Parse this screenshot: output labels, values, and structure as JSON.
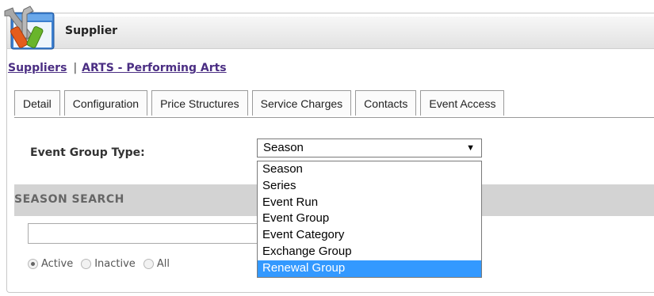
{
  "window": {
    "title": "Supplier"
  },
  "breadcrumb": {
    "items": [
      "Suppliers",
      "ARTS - Performing Arts"
    ],
    "separator": "|"
  },
  "tabs": [
    "Detail",
    "Configuration",
    "Price Structures",
    "Service Charges",
    "Contacts",
    "Event Access"
  ],
  "event_group_type": {
    "label": "Event Group Type:",
    "value": "Season",
    "options": [
      "Season",
      "Series",
      "Event Run",
      "Event Group",
      "Event Category",
      "Exchange Group",
      "Renewal Group"
    ],
    "highlighted": "Renewal Group"
  },
  "season_search": {
    "title": "SEASON SEARCH",
    "input_value": "",
    "radios": [
      {
        "label": "Active",
        "checked": true
      },
      {
        "label": "Inactive",
        "checked": false
      },
      {
        "label": "All",
        "checked": false
      }
    ]
  },
  "colors": {
    "highlight": "#3399ff",
    "link": "#4b2e83",
    "section_bar": "#d3d3d3"
  }
}
